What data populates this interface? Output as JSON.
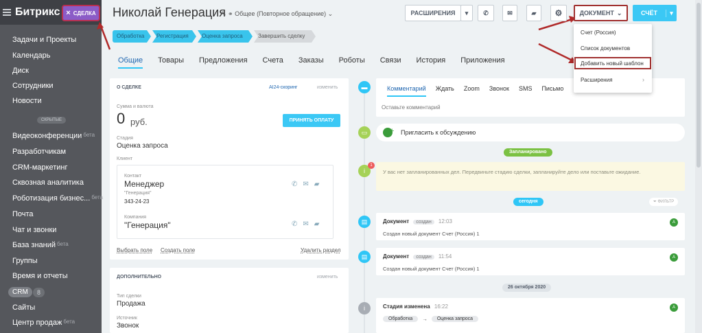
{
  "sidebar": {
    "logo": "Битрикс",
    "logo_suffix": "24",
    "items": [
      {
        "label": "Задачи и Проекты"
      },
      {
        "label": "Календарь"
      },
      {
        "label": "Диск"
      },
      {
        "label": "Сотрудники"
      },
      {
        "label": "Новости"
      },
      {
        "label": "Видеоконференции",
        "beta": "бета"
      },
      {
        "label": "Разработчикам"
      },
      {
        "label": "CRM-маркетинг"
      },
      {
        "label": "Сквозная аналитика"
      },
      {
        "label": "Роботизация бизнес...",
        "beta": "бета"
      },
      {
        "label": "Почта"
      },
      {
        "label": "Чат и звонки"
      },
      {
        "label": "База знаний",
        "beta": "бета"
      },
      {
        "label": "Группы"
      },
      {
        "label": "Время и отчеты"
      },
      {
        "label": "Сайты"
      },
      {
        "label": "Центр продаж",
        "beta": "бета"
      }
    ],
    "hidden_label": "СКРЫТЫЕ",
    "crm_label": "CRM",
    "crm_count": "8"
  },
  "deal_pill": {
    "label": "СДЕЛКА",
    "close_icon": "×"
  },
  "header": {
    "title": "Николай  Генерация",
    "funnel": "Общее (Повторное обращение)",
    "extensions_button": "РАСШИРЕНИЯ",
    "document_button": "ДОКУМЕНТ",
    "bill_button": "СЧЁТ"
  },
  "stages": [
    {
      "label": "Обработка"
    },
    {
      "label": "Регистрация"
    },
    {
      "label": "Оценка запроса"
    },
    {
      "label": "Завершить сделку"
    }
  ],
  "tabs": [
    {
      "label": "Общие"
    },
    {
      "label": "Товары"
    },
    {
      "label": "Предложения"
    },
    {
      "label": "Счета"
    },
    {
      "label": "Заказы"
    },
    {
      "label": "Роботы"
    },
    {
      "label": "Связи"
    },
    {
      "label": "История"
    },
    {
      "label": "Приложения"
    }
  ],
  "deal_card": {
    "title": "О СДЕЛКЕ",
    "scoring": "AI24-скоринг",
    "change": "изменить",
    "amount_label": "Сумма и валюта",
    "amount_value": "0",
    "currency": "руб.",
    "pay_button": "ПРИНЯТЬ ОПЛАТУ",
    "stage_label": "Стадия",
    "stage_value": "Оценка запроса",
    "client_label": "Клиент",
    "contact_label": "Контакт",
    "contact_name": "Менеджер",
    "contact_company": "\"Генерация\"",
    "contact_phone": "343-24-23",
    "company_label": "Компания",
    "company_name": "\"Генерация\"",
    "select_field": "Выбрать поле",
    "create_field": "Создать поле",
    "delete_section": "Удалить раздел"
  },
  "extra_card": {
    "title": "ДОПОЛНИТЕЛЬНО",
    "change": "изменить",
    "type_label": "Тип сделки",
    "type_value": "Продажа",
    "source_label": "Источник",
    "source_value": "Звонок"
  },
  "timeline": {
    "tabs": [
      "Комментарий",
      "Ждать",
      "Zoom",
      "Звонок",
      "SMS",
      "Письмо",
      "...ще"
    ],
    "comment_placeholder": "Оставьте комментарий",
    "invite": "Пригласить к обсуждению",
    "planned_label": "Запланировано",
    "planned_text": "У вас нет запланированных дел. Передвиньте стадию сделки, запланируйте дело или поставьте ожидание.",
    "today_label": "сегодня",
    "filter_label": "ФИЛЬТР",
    "events": [
      {
        "title": "Документ",
        "badge": "создан",
        "time": "12:03",
        "text": "Создан новый документ Счет (Россия) 1"
      },
      {
        "title": "Документ",
        "badge": "создан",
        "time": "11:54",
        "text": "Создан новый документ Счет (Россия) 1"
      }
    ],
    "date_label": "26 октября 2020",
    "stage_change": {
      "title": "Стадия изменена",
      "time": "16:22",
      "from": "Обработка",
      "to": "Оценка запроса"
    },
    "avatar_letter": "А"
  },
  "document_menu": {
    "items": [
      {
        "label": "Счет (Россия)"
      },
      {
        "label": "Список документов"
      },
      {
        "label": "Добавить новый шаблон"
      },
      {
        "label": "Расширения"
      }
    ]
  },
  "colors": {
    "sidebar": "#55575c",
    "accent": "#3bc8f5",
    "annotation": "#a0302f",
    "deal_pill": "#8b5cc7",
    "planned": "#7bc143"
  }
}
